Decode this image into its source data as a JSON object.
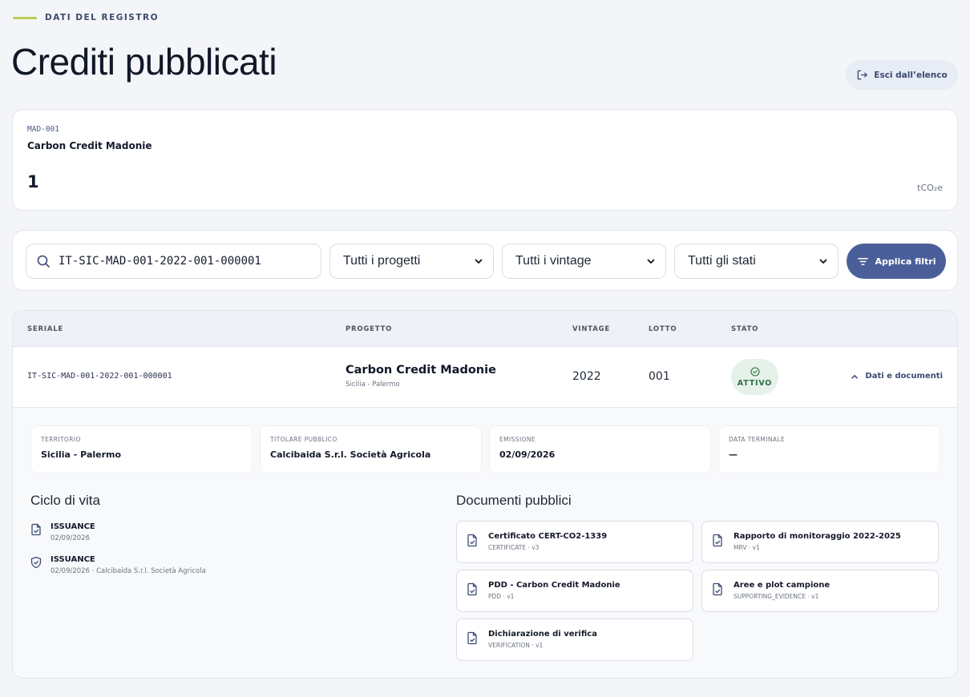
{
  "header": {
    "eyebrow": "DATI DEL REGISTRO",
    "title": "Crediti pubblicati",
    "exit_label": "Esci dall’elenco"
  },
  "summary": {
    "code": "MAD-001",
    "name": "Carbon Credit Madonie",
    "count": "1",
    "unit": "tCO₂e"
  },
  "filters": {
    "search_value": "IT-SIC-MAD-001-2022-001-000001",
    "project_select": "Tutti i progetti",
    "vintage_select": "Tutti i vintage",
    "status_select": "Tutti gli stati",
    "apply_label": "Applica filtri"
  },
  "table": {
    "headers": {
      "serial": "SERIALE",
      "project": "PROGETTO",
      "vintage": "VINTAGE",
      "lot": "LOTTO",
      "status": "STATO"
    },
    "rows": [
      {
        "serial": "IT-SIC-MAD-001-2022-001-000001",
        "project_name": "Carbon Credit Madonie",
        "project_location": "Sicilia - Palermo",
        "vintage": "2022",
        "lot": "001",
        "status": "ATTIVO",
        "toggle_label": "Dati e documenti"
      }
    ]
  },
  "detail": {
    "fields": [
      {
        "label": "TERRITORIO",
        "value": "Sicilia - Palermo"
      },
      {
        "label": "TITOLARE PUBBLICO",
        "value": "Calcibaida S.r.l. Società Agricola"
      },
      {
        "label": "EMISSIONE",
        "value": "02/09/2026"
      },
      {
        "label": "DATA TERMINALE",
        "value": "—"
      }
    ],
    "lifecycle_title": "Ciclo di vita",
    "lifecycle": [
      {
        "title": "ISSUANCE",
        "sub": "02/09/2026",
        "icon": "document-check-icon"
      },
      {
        "title": "ISSUANCE",
        "sub": "02/09/2026 · Calcibaida S.r.l. Società Agricola",
        "icon": "shield-check-icon"
      }
    ],
    "documents_title": "Documenti pubblici",
    "documents": [
      {
        "title": "Certificato CERT-CO2-1339",
        "sub": "CERTIFICATE · v3"
      },
      {
        "title": "Rapporto di monitoraggio 2022-2025",
        "sub": "MRV · v1"
      },
      {
        "title": "PDD - Carbon Credit Madonie",
        "sub": "PDD · v1"
      },
      {
        "title": "Aree e plot campione",
        "sub": "SUPPORTING_EVIDENCE · v1"
      },
      {
        "title": "Dichiarazione di verifica",
        "sub": "VERIFICATION · v1"
      }
    ]
  },
  "colors": {
    "accent": "#4a5f99",
    "eyebrow_line": "#b9cd53",
    "status_bg": "#e6f1ea",
    "status_text": "#2f6f45"
  }
}
